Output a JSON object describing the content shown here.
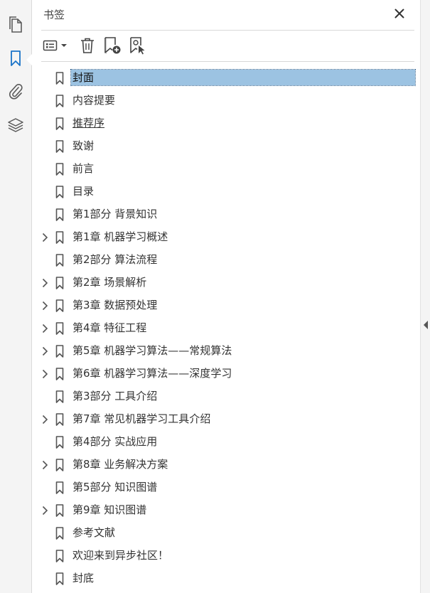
{
  "rail": {
    "items": [
      {
        "icon": "pages-icon",
        "active": false
      },
      {
        "icon": "bookmark-icon",
        "active": true
      },
      {
        "icon": "attachment-icon",
        "active": false
      },
      {
        "icon": "layers-icon",
        "active": false
      }
    ]
  },
  "panel": {
    "title": "书签",
    "close_icon": "close-icon"
  },
  "toolbar": {
    "options_icon": "options-menu-icon",
    "delete_icon": "trash-icon",
    "new_bookmark_icon": "new-bookmark-icon",
    "find_bookmark_icon": "find-current-bookmark-icon"
  },
  "colors": {
    "accent": "#1a73c8",
    "selection": "#9cc3e2",
    "icon": "#5a5a5a"
  },
  "bookmarks": [
    {
      "label": "封面",
      "expandable": false,
      "selected": true,
      "underlined": false
    },
    {
      "label": "内容提要",
      "expandable": false,
      "selected": false,
      "underlined": false
    },
    {
      "label": "推荐序",
      "expandable": false,
      "selected": false,
      "underlined": true
    },
    {
      "label": "致谢",
      "expandable": false,
      "selected": false,
      "underlined": false
    },
    {
      "label": "前言",
      "expandable": false,
      "selected": false,
      "underlined": false
    },
    {
      "label": "目录",
      "expandable": false,
      "selected": false,
      "underlined": false
    },
    {
      "label": "第1部分 背景知识",
      "expandable": false,
      "selected": false,
      "underlined": false
    },
    {
      "label": "第1章 机器学习概述",
      "expandable": true,
      "selected": false,
      "underlined": false
    },
    {
      "label": "第2部分 算法流程",
      "expandable": false,
      "selected": false,
      "underlined": false
    },
    {
      "label": "第2章 场景解析",
      "expandable": true,
      "selected": false,
      "underlined": false
    },
    {
      "label": "第3章 数据预处理",
      "expandable": true,
      "selected": false,
      "underlined": false
    },
    {
      "label": "第4章 特征工程",
      "expandable": true,
      "selected": false,
      "underlined": false
    },
    {
      "label": "第5章 机器学习算法——常规算法",
      "expandable": true,
      "selected": false,
      "underlined": false
    },
    {
      "label": "第6章 机器学习算法——深度学习",
      "expandable": true,
      "selected": false,
      "underlined": false
    },
    {
      "label": "第3部分 工具介绍",
      "expandable": false,
      "selected": false,
      "underlined": false
    },
    {
      "label": "第7章 常见机器学习工具介绍",
      "expandable": true,
      "selected": false,
      "underlined": false
    },
    {
      "label": "第4部分 实战应用",
      "expandable": false,
      "selected": false,
      "underlined": false
    },
    {
      "label": "第8章 业务解决方案",
      "expandable": true,
      "selected": false,
      "underlined": false
    },
    {
      "label": "第5部分 知识图谱",
      "expandable": false,
      "selected": false,
      "underlined": false
    },
    {
      "label": "第9章 知识图谱",
      "expandable": true,
      "selected": false,
      "underlined": false
    },
    {
      "label": "参考文献",
      "expandable": false,
      "selected": false,
      "underlined": false
    },
    {
      "label": "欢迎来到异步社区！",
      "expandable": false,
      "selected": false,
      "underlined": false
    },
    {
      "label": "封底",
      "expandable": false,
      "selected": false,
      "underlined": false
    }
  ]
}
